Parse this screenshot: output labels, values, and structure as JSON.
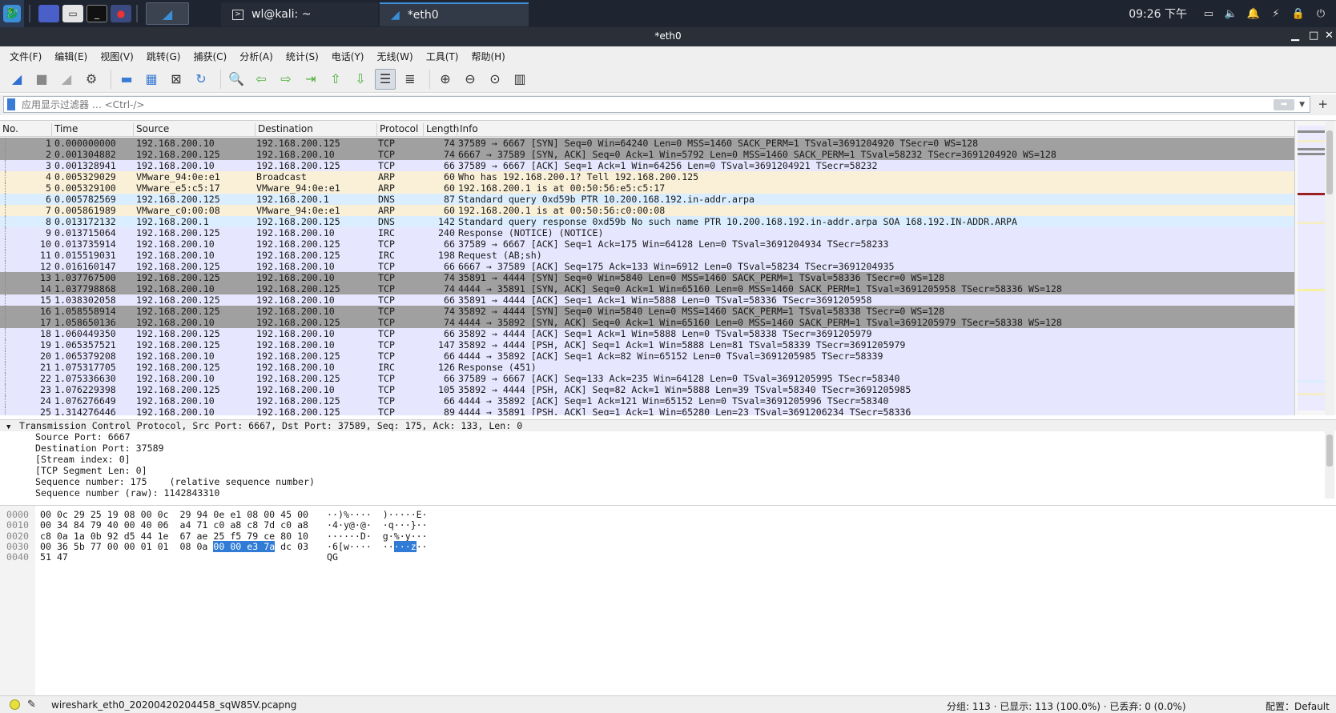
{
  "taskbar": {
    "tasks": [
      {
        "label": "wl@kali: ~"
      },
      {
        "label": "*eth0"
      }
    ],
    "clock": "09:26 下午"
  },
  "window": {
    "title": "*eth0"
  },
  "menu": [
    "文件(F)",
    "编辑(E)",
    "视图(V)",
    "跳转(G)",
    "捕获(C)",
    "分析(A)",
    "统计(S)",
    "电话(Y)",
    "无线(W)",
    "工具(T)",
    "帮助(H)"
  ],
  "filter": {
    "placeholder": "应用显示过滤器 … <Ctrl-/>"
  },
  "packet_list": {
    "columns": [
      "No.",
      "Time",
      "Source",
      "Destination",
      "Protocol",
      "Length",
      "Info"
    ],
    "rows": [
      {
        "no": "1",
        "time": "0.000000000",
        "src": "192.168.200.10",
        "dst": "192.168.200.125",
        "proto": "TCP",
        "len": "74",
        "info": "37589 → 6667 [SYN] Seq=0 Win=64240 Len=0 MSS=1460 SACK_PERM=1 TSval=3691204920 TSecr=0 WS=128",
        "kind": "tcpsyn"
      },
      {
        "no": "2",
        "time": "0.001304882",
        "src": "192.168.200.125",
        "dst": "192.168.200.10",
        "proto": "TCP",
        "len": "74",
        "info": "6667 → 37589 [SYN, ACK] Seq=0 Ack=1 Win=5792 Len=0 MSS=1460 SACK_PERM=1 TSval=58232 TSecr=3691204920 WS=128",
        "kind": "tcpsyn"
      },
      {
        "no": "3",
        "time": "0.001328941",
        "src": "192.168.200.10",
        "dst": "192.168.200.125",
        "proto": "TCP",
        "len": "66",
        "info": "37589 → 6667 [ACK] Seq=1 Ack=1 Win=64256 Len=0 TSval=3691204921 TSecr=58232",
        "kind": "tcp"
      },
      {
        "no": "4",
        "time": "0.005329029",
        "src": "VMware_94:0e:e1",
        "dst": "Broadcast",
        "proto": "ARP",
        "len": "60",
        "info": "Who has 192.168.200.1? Tell 192.168.200.125",
        "kind": "arp"
      },
      {
        "no": "5",
        "time": "0.005329100",
        "src": "VMware_e5:c5:17",
        "dst": "VMware_94:0e:e1",
        "proto": "ARP",
        "len": "60",
        "info": "192.168.200.1 is at 00:50:56:e5:c5:17",
        "kind": "arp"
      },
      {
        "no": "6",
        "time": "0.005782569",
        "src": "192.168.200.125",
        "dst": "192.168.200.1",
        "proto": "DNS",
        "len": "87",
        "info": "Standard query 0xd59b PTR 10.200.168.192.in-addr.arpa",
        "kind": "dns"
      },
      {
        "no": "7",
        "time": "0.005861989",
        "src": "VMware_c0:00:08",
        "dst": "VMware_94:0e:e1",
        "proto": "ARP",
        "len": "60",
        "info": "192.168.200.1 is at 00:50:56:c0:00:08",
        "kind": "arp"
      },
      {
        "no": "8",
        "time": "0.013172132",
        "src": "192.168.200.1",
        "dst": "192.168.200.125",
        "proto": "DNS",
        "len": "142",
        "info": "Standard query response 0xd59b No such name PTR 10.200.168.192.in-addr.arpa SOA 168.192.IN-ADDR.ARPA",
        "kind": "dns"
      },
      {
        "no": "9",
        "time": "0.013715064",
        "src": "192.168.200.125",
        "dst": "192.168.200.10",
        "proto": "IRC",
        "len": "240",
        "info": "Response (NOTICE) (NOTICE)",
        "kind": "irc"
      },
      {
        "no": "10",
        "time": "0.013735914",
        "src": "192.168.200.10",
        "dst": "192.168.200.125",
        "proto": "TCP",
        "len": "66",
        "info": "37589 → 6667 [ACK] Seq=1 Ack=175 Win=64128 Len=0 TSval=3691204934 TSecr=58233",
        "kind": "tcp"
      },
      {
        "no": "11",
        "time": "0.015519031",
        "src": "192.168.200.10",
        "dst": "192.168.200.125",
        "proto": "IRC",
        "len": "198",
        "info": "Request (AB;sh)",
        "kind": "irc"
      },
      {
        "no": "12",
        "time": "0.016160147",
        "src": "192.168.200.125",
        "dst": "192.168.200.10",
        "proto": "TCP",
        "len": "66",
        "info": "6667 → 37589 [ACK] Seq=175 Ack=133 Win=6912 Len=0 TSval=58234 TSecr=3691204935",
        "kind": "tcp"
      },
      {
        "no": "13",
        "time": "1.037767500",
        "src": "192.168.200.125",
        "dst": "192.168.200.10",
        "proto": "TCP",
        "len": "74",
        "info": "35891 → 4444 [SYN] Seq=0 Win=5840 Len=0 MSS=1460 SACK_PERM=1 TSval=58336 TSecr=0 WS=128",
        "kind": "tcpsyn"
      },
      {
        "no": "14",
        "time": "1.037798868",
        "src": "192.168.200.10",
        "dst": "192.168.200.125",
        "proto": "TCP",
        "len": "74",
        "info": "4444 → 35891 [SYN, ACK] Seq=0 Ack=1 Win=65160 Len=0 MSS=1460 SACK_PERM=1 TSval=3691205958 TSecr=58336 WS=128",
        "kind": "tcpsyn"
      },
      {
        "no": "15",
        "time": "1.038302058",
        "src": "192.168.200.125",
        "dst": "192.168.200.10",
        "proto": "TCP",
        "len": "66",
        "info": "35891 → 4444 [ACK] Seq=1 Ack=1 Win=5888 Len=0 TSval=58336 TSecr=3691205958",
        "kind": "tcp"
      },
      {
        "no": "16",
        "time": "1.058558914",
        "src": "192.168.200.125",
        "dst": "192.168.200.10",
        "proto": "TCP",
        "len": "74",
        "info": "35892 → 4444 [SYN] Seq=0 Win=5840 Len=0 MSS=1460 SACK_PERM=1 TSval=58338 TSecr=0 WS=128",
        "kind": "tcpsyn"
      },
      {
        "no": "17",
        "time": "1.058650136",
        "src": "192.168.200.10",
        "dst": "192.168.200.125",
        "proto": "TCP",
        "len": "74",
        "info": "4444 → 35892 [SYN, ACK] Seq=0 Ack=1 Win=65160 Len=0 MSS=1460 SACK_PERM=1 TSval=3691205979 TSecr=58338 WS=128",
        "kind": "tcpsyn"
      },
      {
        "no": "18",
        "time": "1.060449350",
        "src": "192.168.200.125",
        "dst": "192.168.200.10",
        "proto": "TCP",
        "len": "66",
        "info": "35892 → 4444 [ACK] Seq=1 Ack=1 Win=5888 Len=0 TSval=58338 TSecr=3691205979",
        "kind": "tcp"
      },
      {
        "no": "19",
        "time": "1.065357521",
        "src": "192.168.200.125",
        "dst": "192.168.200.10",
        "proto": "TCP",
        "len": "147",
        "info": "35892 → 4444 [PSH, ACK] Seq=1 Ack=1 Win=5888 Len=81 TSval=58339 TSecr=3691205979",
        "kind": "tcp"
      },
      {
        "no": "20",
        "time": "1.065379208",
        "src": "192.168.200.10",
        "dst": "192.168.200.125",
        "proto": "TCP",
        "len": "66",
        "info": "4444 → 35892 [ACK] Seq=1 Ack=82 Win=65152 Len=0 TSval=3691205985 TSecr=58339",
        "kind": "tcp"
      },
      {
        "no": "21",
        "time": "1.075317705",
        "src": "192.168.200.125",
        "dst": "192.168.200.10",
        "proto": "IRC",
        "len": "126",
        "info": "Response (451)",
        "kind": "irc"
      },
      {
        "no": "22",
        "time": "1.075336630",
        "src": "192.168.200.10",
        "dst": "192.168.200.125",
        "proto": "TCP",
        "len": "66",
        "info": "37589 → 6667 [ACK] Seq=133 Ack=235 Win=64128 Len=0 TSval=3691205995 TSecr=58340",
        "kind": "tcp"
      },
      {
        "no": "23",
        "time": "1.076229398",
        "src": "192.168.200.125",
        "dst": "192.168.200.10",
        "proto": "TCP",
        "len": "105",
        "info": "35892 → 4444 [PSH, ACK] Seq=82 Ack=1 Win=5888 Len=39 TSval=58340 TSecr=3691205985",
        "kind": "tcp"
      },
      {
        "no": "24",
        "time": "1.076276649",
        "src": "192.168.200.10",
        "dst": "192.168.200.125",
        "proto": "TCP",
        "len": "66",
        "info": "4444 → 35892 [ACK] Seq=1 Ack=121 Win=65152 Len=0 TSval=3691205996 TSecr=58340",
        "kind": "tcp"
      },
      {
        "no": "25",
        "time": "1.314276446",
        "src": "192.168.200.10",
        "dst": "192.168.200.125",
        "proto": "TCP",
        "len": "89",
        "info": "4444 → 35891 [PSH, ACK] Seq=1 Ack=1 Win=65280 Len=23 TSval=3691206234 TSecr=58336",
        "kind": "tcp"
      }
    ]
  },
  "detail": {
    "header": "Transmission Control Protocol, Src Port: 6667, Dst Port: 37589, Seq: 175, Ack: 133, Len: 0",
    "lines": [
      "Source Port: 6667",
      "Destination Port: 37589",
      "[Stream index: 0]",
      "[TCP Segment Len: 0]",
      "Sequence number: 175    (relative sequence number)",
      "Sequence number (raw): 1142843310"
    ]
  },
  "hex": {
    "rows": [
      {
        "offset": "0000",
        "bytes_pre": "00 0c 29 25 19 08 00 0c  29 94 0e e1 08 00 45 00",
        "bytes_hl": "",
        "bytes_post": "",
        "ascii_pre": "··)%····  )·····E·",
        "ascii_hl": "",
        "ascii_post": ""
      },
      {
        "offset": "0010",
        "bytes_pre": "00 34 84 79 40 00 40 06  a4 71 c0 a8 c8 7d c0 a8",
        "bytes_hl": "",
        "bytes_post": "",
        "ascii_pre": "·4·y@·@·  ·q···}··",
        "ascii_hl": "",
        "ascii_post": ""
      },
      {
        "offset": "0020",
        "bytes_pre": "c8 0a 1a 0b 92 d5 44 1e  67 ae 25 f5 79 ce 80 10",
        "bytes_hl": "",
        "bytes_post": "",
        "ascii_pre": "······D·  g·%·y···",
        "ascii_hl": "",
        "ascii_post": ""
      },
      {
        "offset": "0030",
        "bytes_pre": "00 36 5b 77 00 00 01 01  08 0a ",
        "bytes_hl": "00 00 e3 7a",
        "bytes_post": " dc 03",
        "ascii_pre": "·6[w····  ··",
        "ascii_hl": "···z",
        "ascii_post": "··"
      },
      {
        "offset": "0040",
        "bytes_pre": "51 47",
        "bytes_hl": "",
        "bytes_post": "",
        "ascii_pre": "QG",
        "ascii_hl": "",
        "ascii_post": ""
      }
    ]
  },
  "status": {
    "file": "wireshark_eth0_20200420204458_sqW85V.pcapng",
    "stats": "分组: 113 · 已显示: 113 (100.0%) · 已丢弃: 0 (0.0%)",
    "profile": "配置：Default"
  }
}
